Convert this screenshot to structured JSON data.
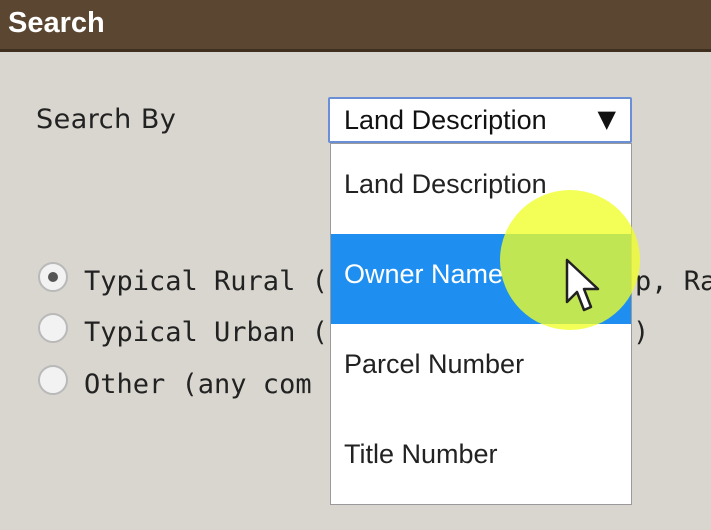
{
  "header": {
    "title": "Search"
  },
  "search_by": {
    "label": "Search By",
    "selected_value": "Land Description",
    "arrow_icon": "▼"
  },
  "dropdown": {
    "options": [
      {
        "label": "Land Description"
      },
      {
        "label": "Owner Name"
      },
      {
        "label": "Parcel Number"
      },
      {
        "label": "Title Number"
      }
    ],
    "highlighted_index": 1
  },
  "radios": [
    {
      "label": "Typical Rural (i.e",
      "tail": "p, Ra",
      "checked": true
    },
    {
      "label": "Typical Urban (i",
      "tail": ")",
      "checked": false
    },
    {
      "label": "Other (any com",
      "tail": "",
      "checked": false
    }
  ],
  "colors": {
    "header_bg": "#5a4631",
    "page_bg": "#d8d6ce",
    "selected_option_bg": "#1e8ff0",
    "highlight": "#f0ff28"
  }
}
